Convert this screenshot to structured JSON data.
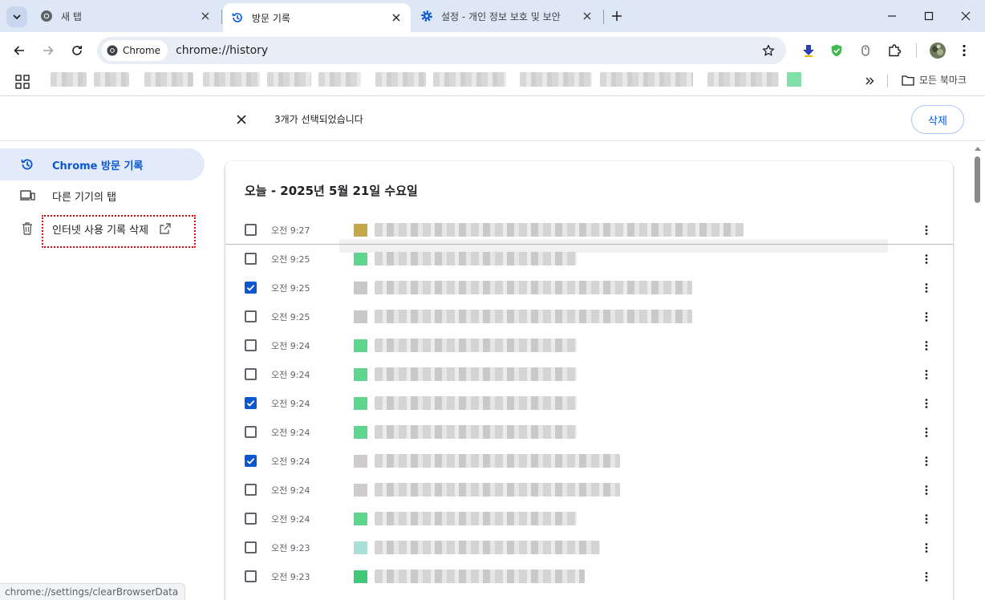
{
  "tabs": [
    {
      "title": "새 탭",
      "icon": "chrome-icon",
      "active": false
    },
    {
      "title": "방문 기록",
      "icon": "history-icon",
      "active": true
    },
    {
      "title": "설정 - 개인 정보 보호 및 보안",
      "icon": "settings-icon",
      "active": false
    }
  ],
  "omnibox": {
    "chip_label": "Chrome",
    "url": "chrome://history"
  },
  "bookmarks": {
    "all_label": "모든 북마크"
  },
  "selection_bar": {
    "count_text": "3개가 선택되었습니다",
    "delete_label": "삭제"
  },
  "sidebar": {
    "items": [
      {
        "label": "Chrome 방문 기록",
        "icon": "history-icon",
        "active": true
      },
      {
        "label": "다른 기기의 탭",
        "icon": "devices-icon",
        "active": false
      },
      {
        "label": "인터넷 사용 기록 삭제",
        "icon": "trash-icon",
        "active": false,
        "external": true
      }
    ]
  },
  "history": {
    "date_title": "오늘 - 2025년 5월 21일 수요일",
    "rows": [
      {
        "time": "오전 9:27",
        "checked": false,
        "favicon_color": "#c4a84a"
      },
      {
        "time": "오전 9:25",
        "checked": false,
        "favicon_color": "#5fd68e"
      },
      {
        "time": "오전 9:25",
        "checked": true,
        "favicon_color": "#c8c8c8"
      },
      {
        "time": "오전 9:25",
        "checked": false,
        "favicon_color": "#c8c8c8"
      },
      {
        "time": "오전 9:24",
        "checked": false,
        "favicon_color": "#5fd68e"
      },
      {
        "time": "오전 9:24",
        "checked": false,
        "favicon_color": "#5fd68e"
      },
      {
        "time": "오전 9:24",
        "checked": true,
        "favicon_color": "#5fd68e"
      },
      {
        "time": "오전 9:24",
        "checked": false,
        "favicon_color": "#5fd68e"
      },
      {
        "time": "오전 9:24",
        "checked": true,
        "favicon_color": "#d0cccc"
      },
      {
        "time": "오전 9:24",
        "checked": false,
        "favicon_color": "#d0cccc"
      },
      {
        "time": "오전 9:24",
        "checked": false,
        "favicon_color": "#5fd68e"
      },
      {
        "time": "오전 9:23",
        "checked": false,
        "favicon_color": "#a8e0d8"
      },
      {
        "time": "오전 9:23",
        "checked": false,
        "favicon_color": "#3ec878"
      }
    ]
  },
  "statusbar": {
    "text": "chrome://settings/clearBrowserData"
  },
  "colors": {
    "accent": "#0b57d0",
    "tabstrip": "#dee7f6",
    "active_nav": "#e3ebfb"
  }
}
